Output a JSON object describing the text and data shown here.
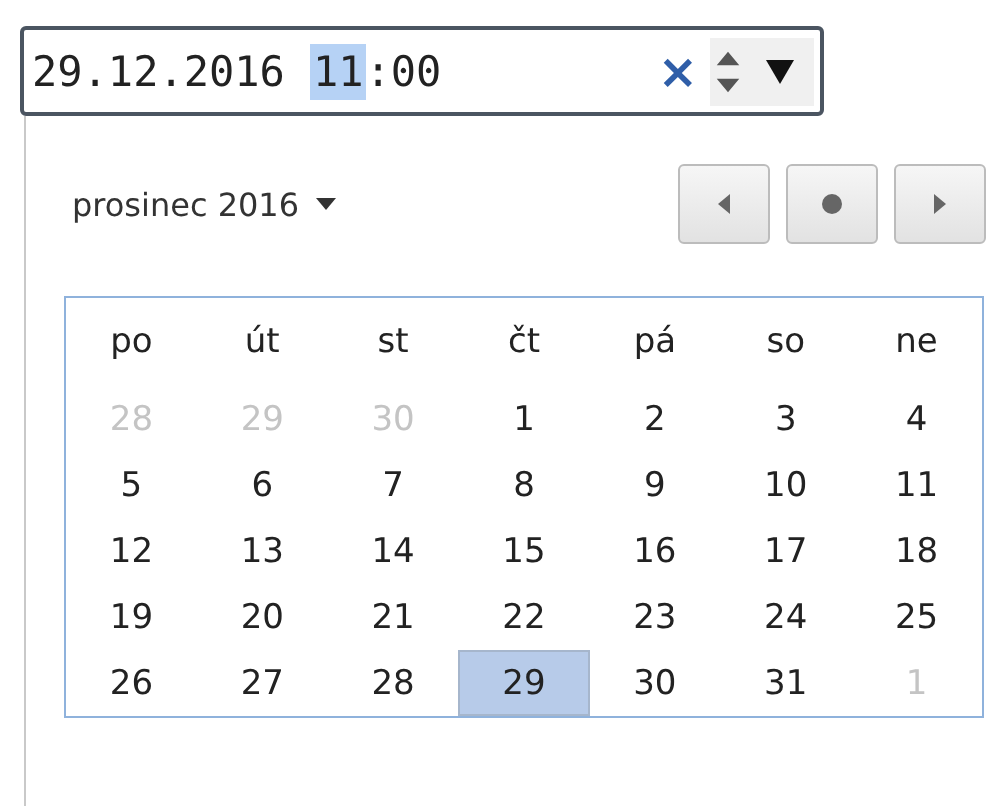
{
  "datetime_field": {
    "date": "29.12.2016",
    "hour": "11",
    "hour_selected": true,
    "separator": ":",
    "minute": "00",
    "clear": "×"
  },
  "calendar": {
    "month_label": "prosinec 2016",
    "weekdays": [
      "po",
      "út",
      "st",
      "čt",
      "pá",
      "so",
      "ne"
    ],
    "weeks": [
      [
        {
          "day": "28",
          "outside": true,
          "selected": false
        },
        {
          "day": "29",
          "outside": true,
          "selected": false
        },
        {
          "day": "30",
          "outside": true,
          "selected": false
        },
        {
          "day": "1",
          "outside": false,
          "selected": false
        },
        {
          "day": "2",
          "outside": false,
          "selected": false
        },
        {
          "day": "3",
          "outside": false,
          "selected": false
        },
        {
          "day": "4",
          "outside": false,
          "selected": false
        }
      ],
      [
        {
          "day": "5",
          "outside": false,
          "selected": false
        },
        {
          "day": "6",
          "outside": false,
          "selected": false
        },
        {
          "day": "7",
          "outside": false,
          "selected": false
        },
        {
          "day": "8",
          "outside": false,
          "selected": false
        },
        {
          "day": "9",
          "outside": false,
          "selected": false
        },
        {
          "day": "10",
          "outside": false,
          "selected": false
        },
        {
          "day": "11",
          "outside": false,
          "selected": false
        }
      ],
      [
        {
          "day": "12",
          "outside": false,
          "selected": false
        },
        {
          "day": "13",
          "outside": false,
          "selected": false
        },
        {
          "day": "14",
          "outside": false,
          "selected": false
        },
        {
          "day": "15",
          "outside": false,
          "selected": false
        },
        {
          "day": "16",
          "outside": false,
          "selected": false
        },
        {
          "day": "17",
          "outside": false,
          "selected": false
        },
        {
          "day": "18",
          "outside": false,
          "selected": false
        }
      ],
      [
        {
          "day": "19",
          "outside": false,
          "selected": false
        },
        {
          "day": "20",
          "outside": false,
          "selected": false
        },
        {
          "day": "21",
          "outside": false,
          "selected": false
        },
        {
          "day": "22",
          "outside": false,
          "selected": false
        },
        {
          "day": "23",
          "outside": false,
          "selected": false
        },
        {
          "day": "24",
          "outside": false,
          "selected": false
        },
        {
          "day": "25",
          "outside": false,
          "selected": false
        }
      ],
      [
        {
          "day": "26",
          "outside": false,
          "selected": false
        },
        {
          "day": "27",
          "outside": false,
          "selected": false
        },
        {
          "day": "28",
          "outside": false,
          "selected": false
        },
        {
          "day": "29",
          "outside": false,
          "selected": true
        },
        {
          "day": "30",
          "outside": false,
          "selected": false
        },
        {
          "day": "31",
          "outside": false,
          "selected": false
        },
        {
          "day": "1",
          "outside": true,
          "selected": false
        }
      ]
    ]
  }
}
